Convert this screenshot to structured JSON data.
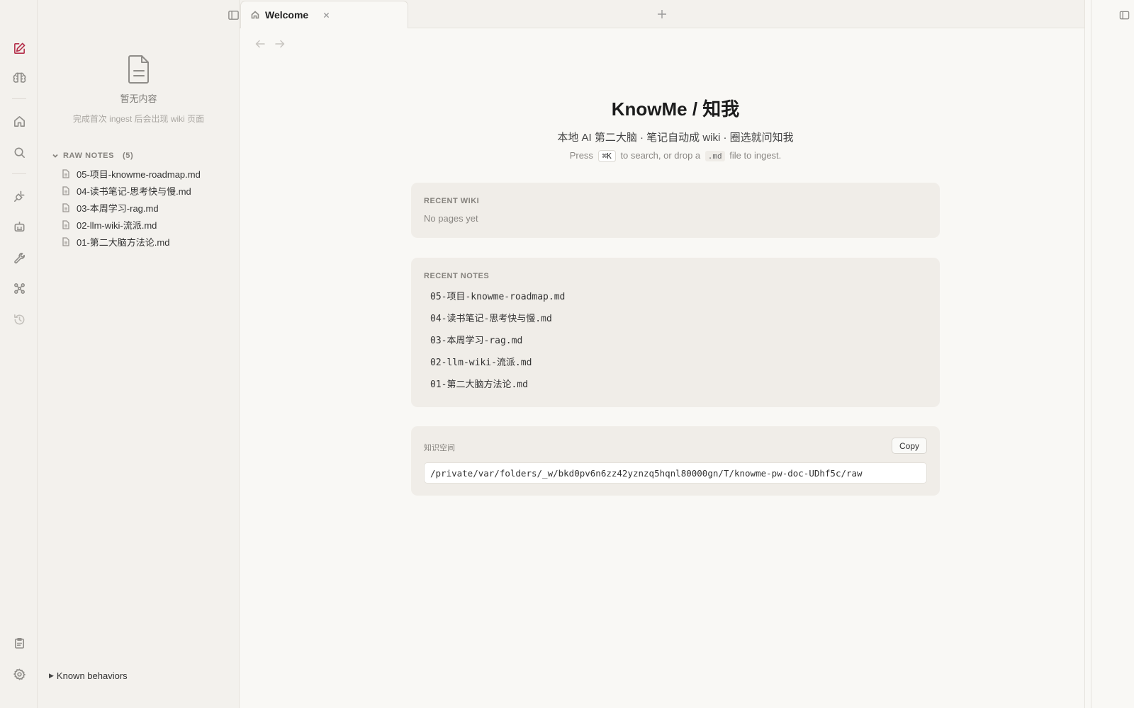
{
  "tabs": [
    {
      "label": "Welcome",
      "icon": "home-icon"
    }
  ],
  "sidebar": {
    "empty_title": "暂无内容",
    "empty_subtitle": "完成首次 ingest 后会出现 wiki 页面",
    "raw_notes_label": "RAW NOTES",
    "raw_notes_count": "(5)",
    "files": [
      "05-项目-knowme-roadmap.md",
      "04-读书笔记-思考快与慢.md",
      "03-本周学习-rag.md",
      "02-llm-wiki-流派.md",
      "01-第二大脑方法论.md"
    ],
    "known_behaviors": "Known behaviors"
  },
  "main": {
    "title": "KnowMe / 知我",
    "subtitle": "本地 AI 第二大脑 · 笔记自动成 wiki · 圈选就问知我",
    "hint_press": "Press",
    "hint_key": "⌘K",
    "hint_middle": "to search, or drop a",
    "hint_code": ".md",
    "hint_end": "file to ingest.",
    "recent_wiki_label": "RECENT WIKI",
    "recent_wiki_empty": "No pages yet",
    "recent_notes_label": "RECENT NOTES",
    "recent_notes": [
      "05-项目-knowme-roadmap.md",
      "04-读书笔记-思考快与慢.md",
      "03-本周学习-rag.md",
      "02-llm-wiki-流派.md",
      "01-第二大脑方法论.md"
    ],
    "space_label": "知识空间",
    "copy_label": "Copy",
    "space_path": "/private/var/folders/_w/bkd0pv6n6zz42yznzq5hqnl80000gn/T/knowme-pw-doc-UDhf5c/raw"
  },
  "colors": {
    "accent": "#b5304b",
    "background": "#f9f8f5",
    "panel": "#f3f1ed",
    "card": "#f0ede8"
  }
}
